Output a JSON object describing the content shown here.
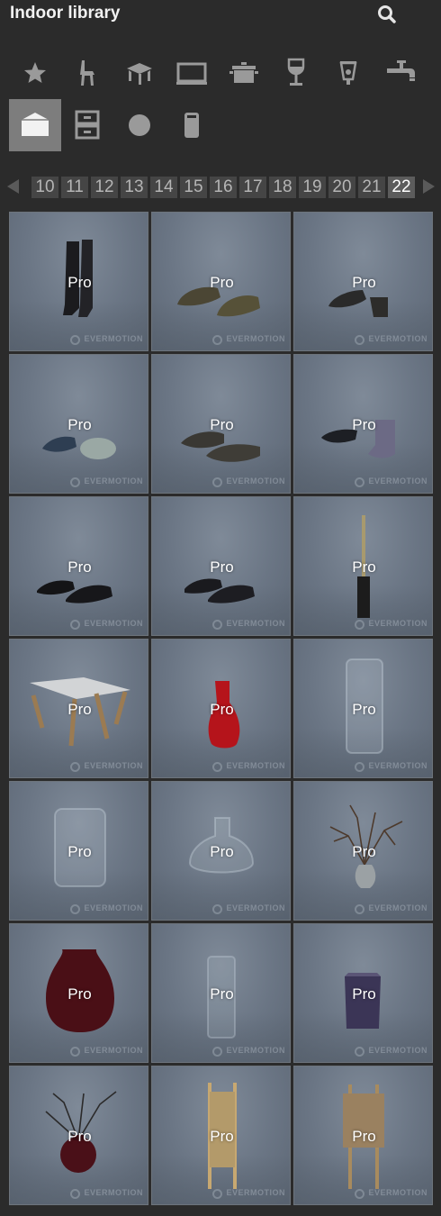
{
  "header": {
    "title": "Indoor library",
    "search_icon": "search-icon"
  },
  "categories": [
    {
      "icon": "star-icon",
      "active": false
    },
    {
      "icon": "chair-icon",
      "active": false
    },
    {
      "icon": "table-icon",
      "active": false
    },
    {
      "icon": "monitor-icon",
      "active": false
    },
    {
      "icon": "pot-icon",
      "active": false
    },
    {
      "icon": "wine-glass-icon",
      "active": false
    },
    {
      "icon": "lamp-icon",
      "active": false
    },
    {
      "icon": "faucet-icon",
      "active": false
    },
    {
      "icon": "box-icon",
      "active": true
    },
    {
      "icon": "cabinet-icon",
      "active": false
    },
    {
      "icon": "circle-icon",
      "active": false
    },
    {
      "icon": "cylinder-icon",
      "active": false
    }
  ],
  "pager": {
    "pages": [
      "10",
      "11",
      "12",
      "13",
      "14",
      "15",
      "16",
      "17",
      "18",
      "19",
      "20",
      "21",
      "22"
    ],
    "current": "22"
  },
  "tiles": [
    {
      "badge": "Pro",
      "watermark": "EVERMOTION",
      "object": "boots"
    },
    {
      "badge": "Pro",
      "watermark": "EVERMOTION",
      "object": "leather-shoes"
    },
    {
      "badge": "Pro",
      "watermark": "EVERMOTION",
      "object": "ankle-boots"
    },
    {
      "badge": "Pro",
      "watermark": "EVERMOTION",
      "object": "sneakers-blue"
    },
    {
      "badge": "Pro",
      "watermark": "EVERMOTION",
      "object": "sandals"
    },
    {
      "badge": "Pro",
      "watermark": "EVERMOTION",
      "object": "high-top-sneakers"
    },
    {
      "badge": "Pro",
      "watermark": "EVERMOTION",
      "object": "slip-on-shoes"
    },
    {
      "badge": "Pro",
      "watermark": "EVERMOTION",
      "object": "sneakers-dark"
    },
    {
      "badge": "Pro",
      "watermark": "EVERMOTION",
      "object": "toilet-brush"
    },
    {
      "badge": "Pro",
      "watermark": "EVERMOTION",
      "object": "magazine-stool"
    },
    {
      "badge": "Pro",
      "watermark": "EVERMOTION",
      "object": "red-vase"
    },
    {
      "badge": "Pro",
      "watermark": "EVERMOTION",
      "object": "glass-cylinder"
    },
    {
      "badge": "Pro",
      "watermark": "EVERMOTION",
      "object": "glass-jar"
    },
    {
      "badge": "Pro",
      "watermark": "EVERMOTION",
      "object": "glass-bowl"
    },
    {
      "badge": "Pro",
      "watermark": "EVERMOTION",
      "object": "branch-vase"
    },
    {
      "badge": "Pro",
      "watermark": "EVERMOTION",
      "object": "dark-red-vase"
    },
    {
      "badge": "Pro",
      "watermark": "EVERMOTION",
      "object": "glass-bottle"
    },
    {
      "badge": "Pro",
      "watermark": "EVERMOTION",
      "object": "purple-pot"
    },
    {
      "badge": "Pro",
      "watermark": "EVERMOTION",
      "object": "blossom-vase"
    },
    {
      "badge": "Pro",
      "watermark": "EVERMOTION",
      "object": "wooden-ladder"
    },
    {
      "badge": "Pro",
      "watermark": "EVERMOTION",
      "object": "wooden-ladder-towel"
    }
  ]
}
